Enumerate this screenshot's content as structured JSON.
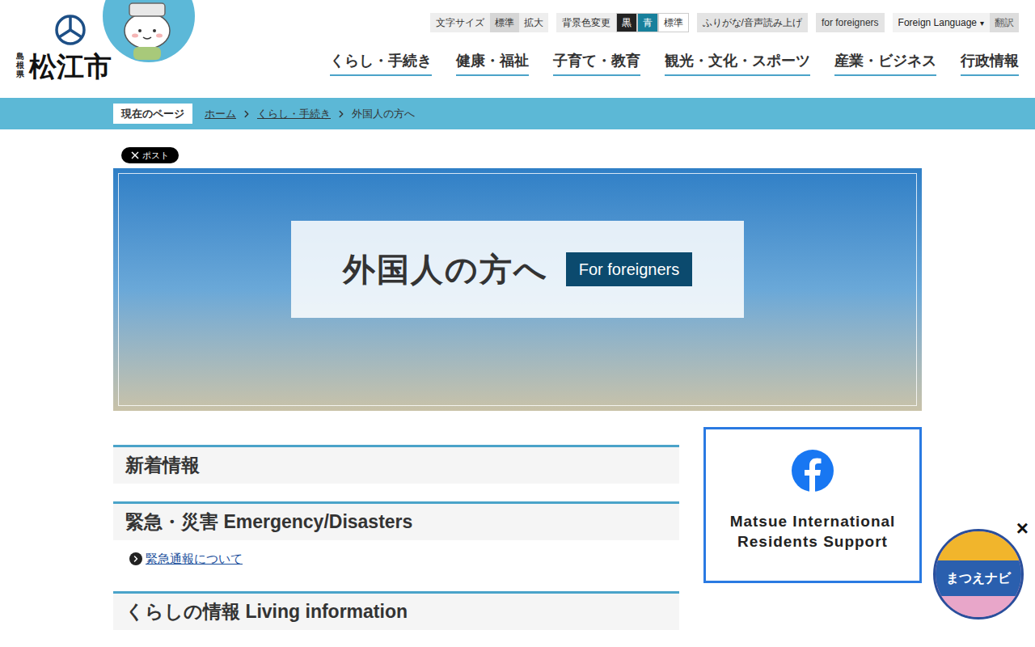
{
  "header": {
    "prefecture": "島根県",
    "city": "松江市"
  },
  "utility": {
    "font_size": {
      "label": "文字サイズ",
      "options": [
        {
          "label": "標準",
          "selected": true
        },
        {
          "label": "拡大",
          "selected": false
        }
      ]
    },
    "background": {
      "label": "背景色変更",
      "options": [
        {
          "label": "黒",
          "color": "#222222",
          "text_color": "#ffffff"
        },
        {
          "label": "青",
          "color": "#17809c",
          "text_color": "#ffffff"
        },
        {
          "label": "標準",
          "color": "#ffffff",
          "text_color": "#333333"
        }
      ]
    },
    "links": [
      "ふりがな/音声読み上げ",
      "for foreigners"
    ],
    "language": {
      "label": "Foreign Language",
      "caret": "▾"
    },
    "translate": "翻訳"
  },
  "nav": [
    "くらし・手続き",
    "健康・福祉",
    "子育て・教育",
    "観光・文化・スポーツ",
    "産業・ビジネス",
    "行政情報"
  ],
  "breadcrumb": {
    "label": "現在のページ",
    "items": [
      {
        "label": "ホーム",
        "link": true
      },
      {
        "label": "くらし・手続き",
        "link": true
      },
      {
        "label": "外国人の方へ",
        "link": false
      }
    ]
  },
  "share": {
    "label": "ポスト"
  },
  "hero": {
    "title": "外国人の方へ",
    "badge": "For foreigners"
  },
  "sections": [
    {
      "title": "新着情報",
      "links": []
    },
    {
      "title": "緊急・災害 Emergency/Disasters",
      "links": [
        "緊急通報について"
      ]
    },
    {
      "title": "くらしの情報 Living information",
      "links": []
    }
  ],
  "facebook_card": {
    "title_lines": [
      "Matsue International",
      "Residents Support"
    ]
  },
  "floating_nav": {
    "label": "まつえナビ",
    "close": "×"
  }
}
